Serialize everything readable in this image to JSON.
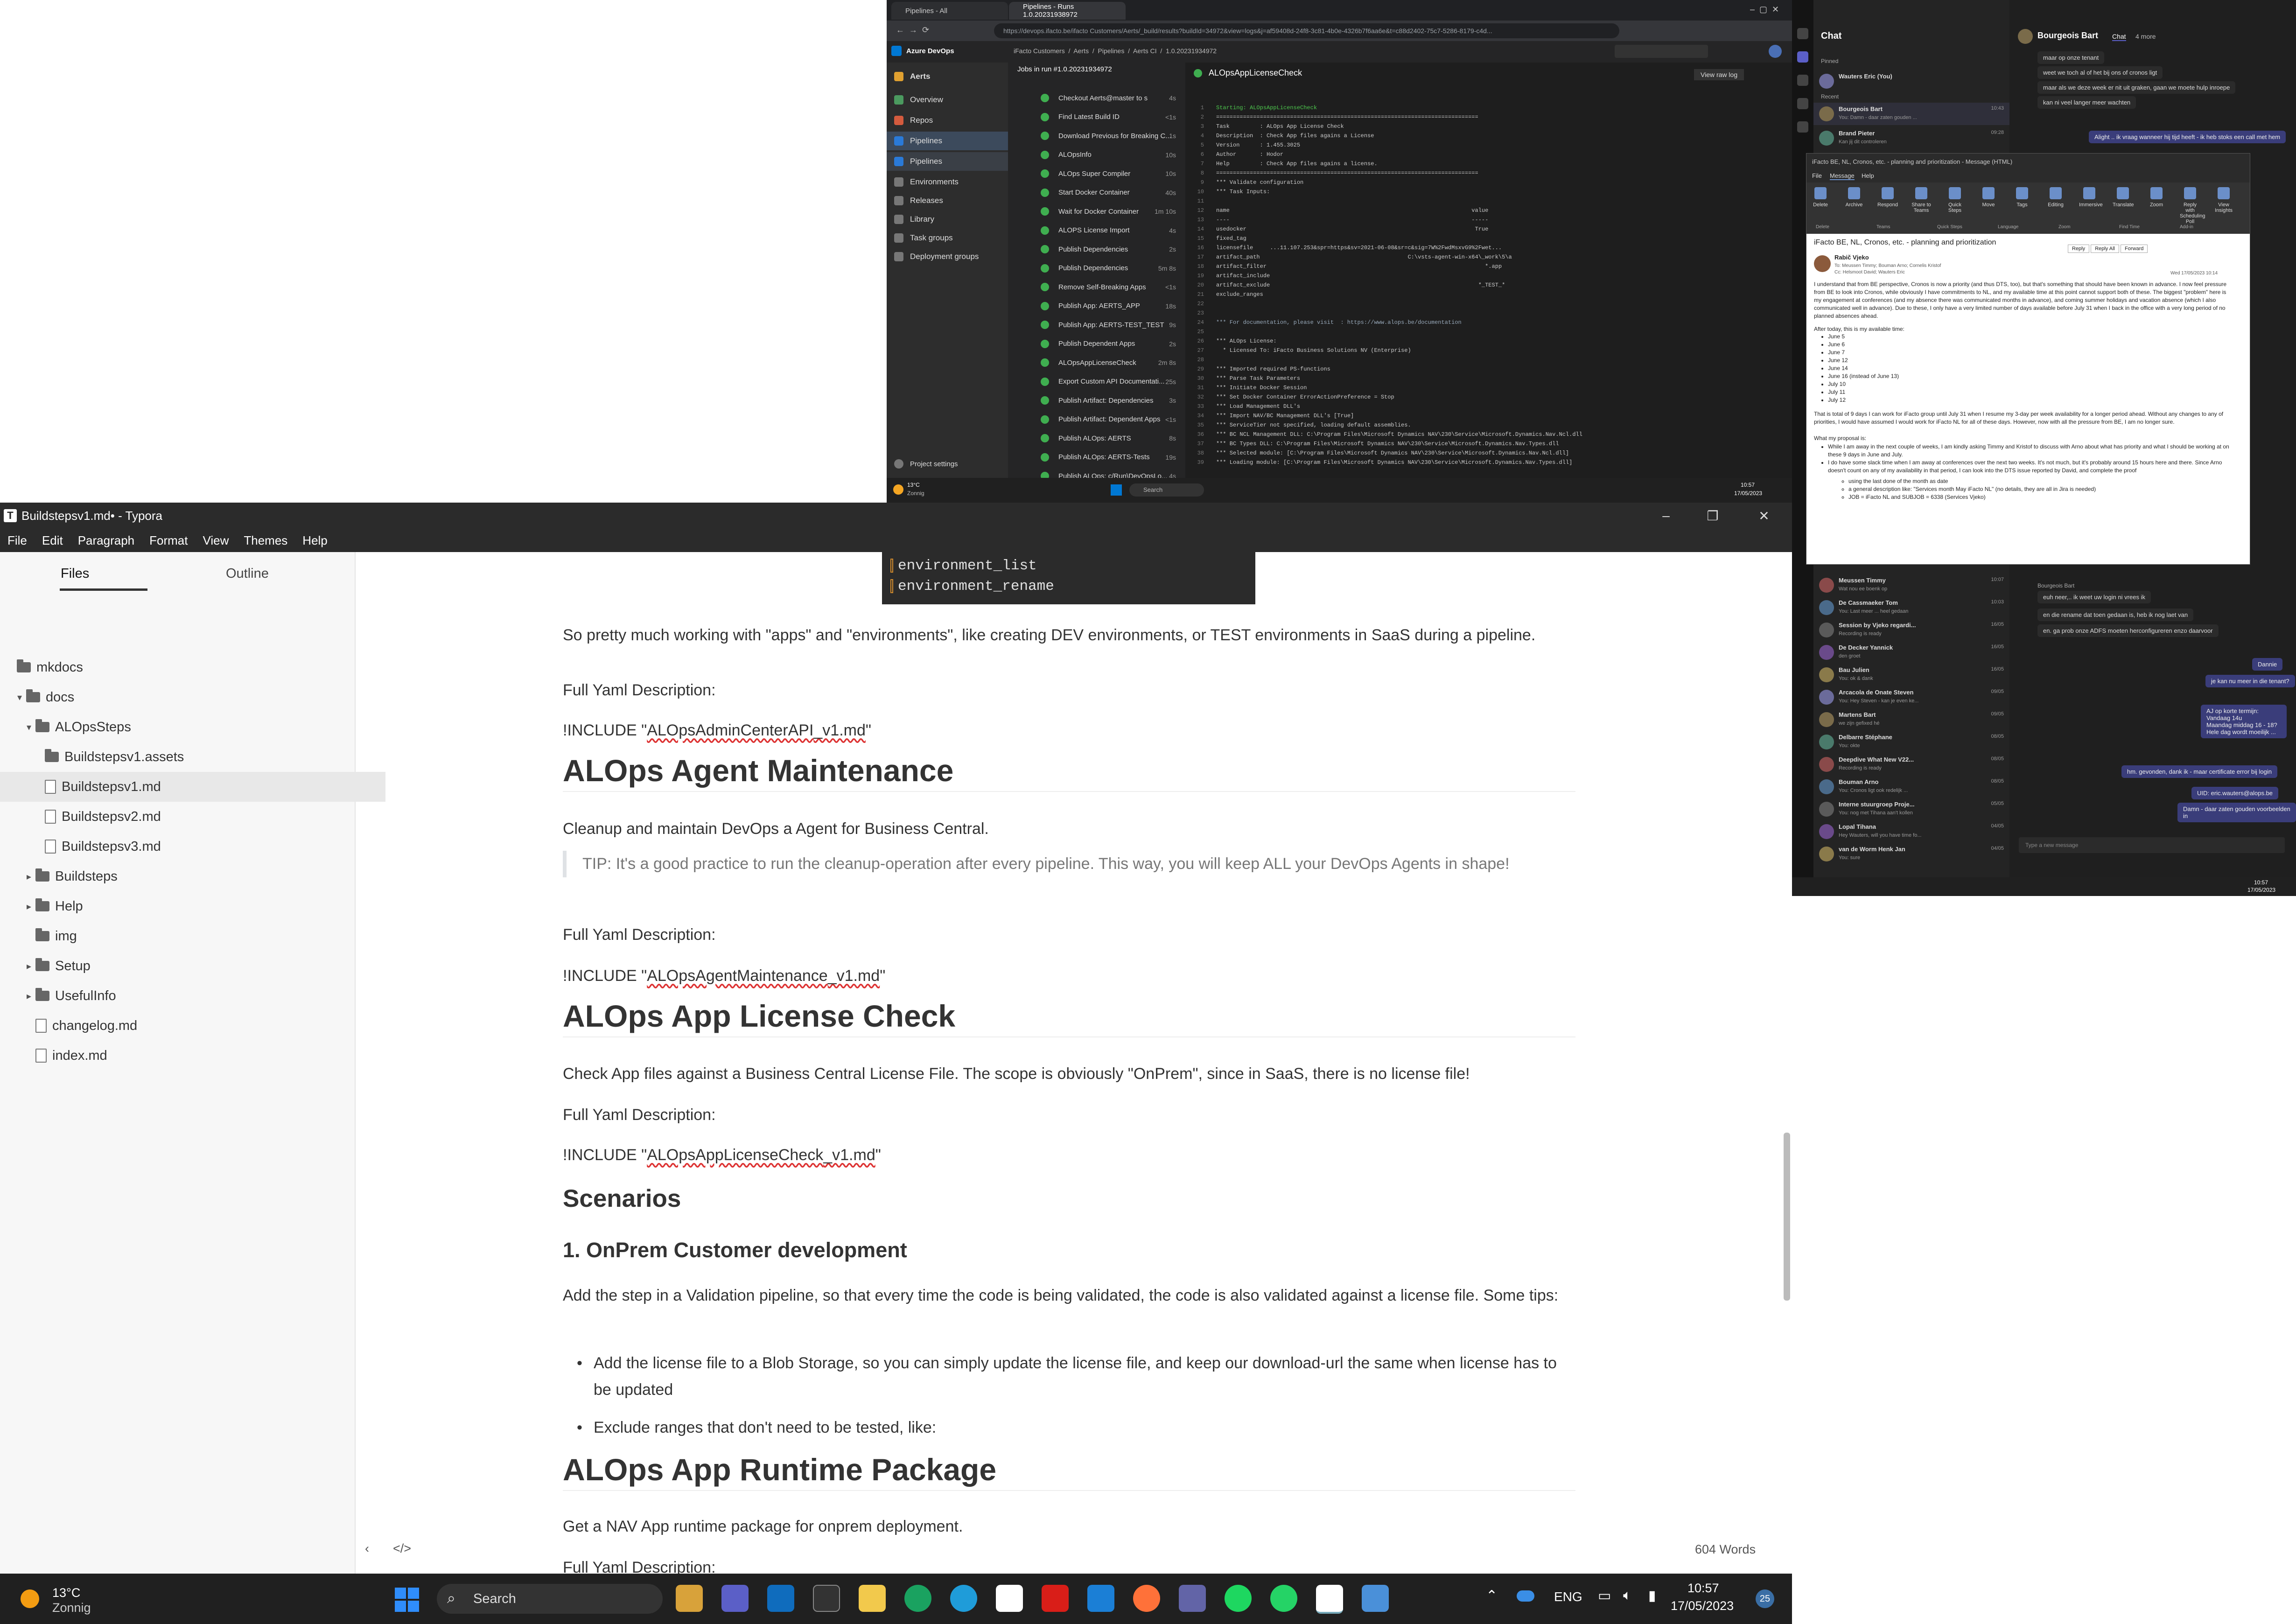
{
  "typora": {
    "title": "Buildstepsv1.md• - Typora",
    "menu": [
      "File",
      "Edit",
      "Paragraph",
      "Format",
      "View",
      "Themes",
      "Help"
    ],
    "tabs": {
      "files": "Files",
      "outline": "Outline"
    },
    "tree": [
      {
        "label": "mkdocs",
        "type": "folder",
        "depth": 0,
        "arrow": ""
      },
      {
        "label": "docs",
        "type": "folder",
        "depth": 1,
        "arrow": "▾"
      },
      {
        "label": "ALOpsSteps",
        "type": "folder",
        "depth": 2,
        "arrow": "▾"
      },
      {
        "label": "Buildstepsv1.assets",
        "type": "folder",
        "depth": 3,
        "arrow": ""
      },
      {
        "label": "Buildstepsv1.md",
        "type": "file",
        "depth": 3,
        "arrow": "",
        "selected": true
      },
      {
        "label": "Buildstepsv2.md",
        "type": "file",
        "depth": 3,
        "arrow": ""
      },
      {
        "label": "Buildstepsv3.md",
        "type": "file",
        "depth": 3,
        "arrow": ""
      },
      {
        "label": "Buildsteps",
        "type": "folder",
        "depth": 2,
        "arrow": "▸"
      },
      {
        "label": "Help",
        "type": "folder",
        "depth": 2,
        "arrow": "▸"
      },
      {
        "label": "img",
        "type": "folder",
        "depth": 2,
        "arrow": ""
      },
      {
        "label": "Setup",
        "type": "folder",
        "depth": 2,
        "arrow": "▸"
      },
      {
        "label": "UsefulInfo",
        "type": "folder",
        "depth": 2,
        "arrow": "▸"
      },
      {
        "label": "changelog.md",
        "type": "file",
        "depth": 2,
        "arrow": ""
      },
      {
        "label": "index.md",
        "type": "file",
        "depth": 2,
        "arrow": ""
      }
    ],
    "code_lines": [
      "environment_list",
      "environment_rename"
    ],
    "doc": {
      "p1": "So pretty much working with \"apps\" and \"environments\", like creating DEV environments, or TEST environments in SaaS during a pipeline.",
      "full_yaml": "Full Yaml Description:",
      "include_pre": "!INCLUDE \"",
      "include_post": "\"",
      "inc1": "ALOpsAdminCenterAPI",
      "inc1_suffix": "_v1.md",
      "h_agent": "ALOps Agent Maintenance",
      "agent_desc": "Cleanup and maintain DevOps a Agent for Business Central.",
      "tip": "TIP: It's a good practice to run the cleanup-operation after every pipeline.  This way, you will keep ALL your DevOps Agents in shape!",
      "inc2": "ALOpsAgentMaintenance",
      "inc2_suffix": "_v1.md",
      "h_license": "ALOps App License Check",
      "license_desc": "Check App files against a Business Central License File.  The scope is obviously \"OnPrem\", since in SaaS, there is no license file!",
      "inc3": "ALOpsAppLicenseCheck",
      "inc3_suffix": "_v1.md",
      "h_scen": "Scenarios",
      "h_onprem": "1. OnPrem Customer development",
      "onprem_desc": "Add the step in a Validation pipeline, so that every time the code is being validated, the code is also validated against a license file.  Some tips:",
      "bullet1": "Add the license file to a Blob Storage, so you can simply update the license file, and keep our download-url the same when license has to be updated",
      "bullet2": "Exclude ranges that don't need to be tested, like:",
      "h_runtime": "ALOps App Runtime Package",
      "runtime_desc": "Get a NAV App runtime package for onprem deployment.",
      "runtime_next": "Full Yaml Description:"
    },
    "word_count": "604 Words"
  },
  "taskbar": {
    "weather_temp": "13°C",
    "weather_desc": "Zonnig",
    "search": "Search",
    "lang": "ENG",
    "time": "10:57",
    "date": "17/05/2023",
    "badge": "25"
  },
  "ado": {
    "tabs": [
      "Pipelines - All",
      "Pipelines - Runs 1.0.20231938972"
    ],
    "url": "https://devops.ifacto.be/ifacto Customers/Aerts/_build/results?buildId=34972&view=logs&j=af59408d-24f8-3c81-4b0e-4326b7f6aa6e&t=c88d2402-75c7-5286-8179-c4d...",
    "brand": "Azure DevOps",
    "breadcrumb": [
      "iFacto Customers",
      "Aerts",
      "Pipelines",
      "Aerts CI",
      "1.0.20231934972"
    ],
    "project": "Aerts",
    "nav": [
      "Overview",
      "Repos",
      "Pipelines",
      "Pipelines",
      "Environments",
      "Releases",
      "Library",
      "Task groups",
      "Deployment groups"
    ],
    "project_settings": "Project settings",
    "jobs_title": "Jobs in run #1.0.20231934972",
    "jobs": [
      {
        "name": "Checkout Aerts@master to s",
        "dur": "4s"
      },
      {
        "name": "Find Latest Build ID",
        "dur": "<1s"
      },
      {
        "name": "Download Previous for Breaking C...",
        "dur": "1s"
      },
      {
        "name": "ALOpsInfo",
        "dur": "10s"
      },
      {
        "name": "ALOps Super Compiler",
        "dur": "10s"
      },
      {
        "name": "Start Docker Container",
        "dur": "40s"
      },
      {
        "name": "Wait for Docker Container",
        "dur": "1m 10s"
      },
      {
        "name": "ALOPS License Import",
        "dur": "4s"
      },
      {
        "name": "Publish Dependencies",
        "dur": "2s"
      },
      {
        "name": "Publish Dependencies",
        "dur": "5m 8s"
      },
      {
        "name": "Remove Self-Breaking Apps",
        "dur": "<1s"
      },
      {
        "name": "Publish App: AERTS_APP",
        "dur": "18s"
      },
      {
        "name": "Publish App: AERTS-TEST_TEST",
        "dur": "9s"
      },
      {
        "name": "Publish Dependent Apps",
        "dur": "2s"
      },
      {
        "name": "ALOpsAppLicenseCheck",
        "dur": "2m 8s"
      },
      {
        "name": "Export Custom API Documentati...",
        "dur": "25s"
      },
      {
        "name": "Publish Artifact: Dependencies",
        "dur": "3s"
      },
      {
        "name": "Publish Artifact: Dependent Apps",
        "dur": "<1s"
      },
      {
        "name": "Publish ALOps: AERTS",
        "dur": "8s"
      },
      {
        "name": "Publish ALOps: AERTS-Tests",
        "dur": "19s"
      },
      {
        "name": "Publish ALOps: c/Run\\DevOpsLo...",
        "dur": "4s"
      }
    ],
    "log_title": "ALOpsAppLicenseCheck",
    "view_raw": "View raw log",
    "log_lines": [
      "Starting: ALOpsAppLicenseCheck",
      "==============================================================================",
      "Task         : ALOps App License Check",
      "Description  : Check App files agains a License",
      "Version      : 1.455.3025",
      "Author       : Hodor",
      "Help         : Check App files agains a license.",
      "==============================================================================",
      "*** Validate configuration",
      "*** Task Inputs:",
      "",
      "name                                                                        value",
      "----                                                                        -----",
      "usedocker                                                                    True",
      "fixed_tag",
      "licensefile     ...11.107.253&spr=https&sv=2021-06-08&sr=c&sig=7W%2FwdMsxvG9%2Fwet...",
      "artifact_path                                            C:\\vsts-agent-win-x64\\_work\\5\\a",
      "artifact_filter                                                                 *.app",
      "artifact_include",
      "artifact_exclude                                                              *_TEST_*",
      "exclude_ranges",
      "",
      "",
      "*** For documentation, please visit  : https://www.alops.be/documentation",
      "",
      "*** ALOps License:",
      "  * Licensed To: iFacto Business Solutions NV (Enterprise)",
      "",
      "*** Imported required PS-functions",
      "*** Parse Task Parameters",
      "*** Initiate Docker Session",
      "*** Set Docker Container ErrorActionPreference = Stop",
      "*** Load Management DLL's",
      "*** Import NAV/BC Management DLL's [True]",
      "*** ServiceTier not specified, loading default assemblies.",
      "*** BC NCL Management DLL: C:\\Program Files\\Microsoft Dynamics NAV\\230\\Service\\Microsoft.Dynamics.Nav.Ncl.dll",
      "*** BC Types DLL: C:\\Program Files\\Microsoft Dynamics NAV\\230\\Service\\Microsoft.Dynamics.Nav.Types.dll",
      "*** Selected module: [C:\\Program Files\\Microsoft Dynamics NAV\\230\\Service\\Microsoft.Dynamics.Nav.Ncl.dll]",
      "*** Loading module: [C:\\Program Files\\Microsoft Dynamics NAV\\230\\Service\\Microsoft.Dynamics.Nav.Types.dll]"
    ],
    "tb_temp": "13°C",
    "tb_desc": "Zonnig",
    "tb_search": "Search",
    "tb_time": "10:57",
    "tb_date": "17/05/2023"
  },
  "teams": {
    "header": "Chat",
    "chat_person": "Bourgeois Bart",
    "chat_tab": "Chat",
    "more": "4 more",
    "pinned": "Pinned",
    "recent": "Recent",
    "list": [
      {
        "name": "Wauters Eric (You)",
        "preview": "",
        "date": ""
      },
      {
        "name": "Bourgeois Bart",
        "preview": "You: Damn - daar zaten gouden ...",
        "date": "10:43"
      },
      {
        "name": "Brand Pieter",
        "preview": "Kan jij dit controleren",
        "date": "09:28"
      },
      {
        "name": "Meussen Timmy",
        "preview": "Wat nou ee boenk op",
        "date": "10:07"
      },
      {
        "name": "De Cassmaeker Tom",
        "preview": "You: Last meer ... heel gedaan",
        "date": "10:03"
      },
      {
        "name": "Session by Vjeko regardi...",
        "preview": "Recording is ready",
        "date": "16/05"
      },
      {
        "name": "De Decker Yannick",
        "preview": "den groet",
        "date": "16/05"
      },
      {
        "name": "Bau Julien",
        "preview": "You: ok & dank",
        "date": "16/05"
      },
      {
        "name": "Arcacola de Onate Steven",
        "preview": "You: Hey Steven - kan je even ke...",
        "date": "09/05"
      },
      {
        "name": "Martens Bart",
        "preview": "we zijn gefixed hé",
        "date": "09/05"
      },
      {
        "name": "Delbarre Stéphane",
        "preview": "You: okte",
        "date": "08/05"
      },
      {
        "name": "Deepdive What New V22...",
        "preview": "Recording is ready",
        "date": "08/05"
      },
      {
        "name": "Bouman Arno",
        "preview": "You: Cronos ligt ook redelijk ...",
        "date": "08/05"
      },
      {
        "name": "Interne stuurgroep Proje...",
        "preview": "You: nog met Tihana aan't kollen",
        "date": "05/05"
      },
      {
        "name": "Lopal Tihana",
        "preview": "Hey Wauters, will you have time fo...",
        "date": "04/05"
      },
      {
        "name": "van de Worm Henk Jan",
        "preview": "You: sure",
        "date": "04/05"
      }
    ],
    "messages_top": [
      "maar op onze tenant",
      "weet we toch al of het bij ons of cronos ligt",
      "maar als we deze week er nit uit graken, gaan we moete hulp inroepe",
      "kan ni veel langer meer wachten"
    ],
    "msg_me_top": "Alight .. ik vraag wanneer hij tijd heeft - ik heb stoks een call met hem",
    "messages_mid": [
      "euh neer,.. ik weet uw login ni vrees ik",
      "en die rename dat toen gedaan is, heb ik nog laet van",
      "en. ga prob onze ADFS moeten herconfigureren enzo daarvoor"
    ],
    "sender_mid": "Bourgeois Bart",
    "me_msgs": [
      "Dannie",
      "je kan nu meer in die tenant?",
      "AJ op korte termijn:",
      "Vandaag 14u",
      "Maandag middag 16 - 18?",
      "Hele dag wordt moeilijk ...",
      "hm. gevonden, dank ik - maar certificate error bij login",
      "UID: eric.wauters@alops.be",
      "Damn - daar zaten gouden voorbeelden in"
    ],
    "compose": "Type a new message",
    "tb_time": "10:57",
    "tb_date": "17/05/2023"
  },
  "mail": {
    "window_title": "iFacto BE, NL, Cronos, etc. - planning and prioritization - Message (HTML)",
    "tabs": [
      "File",
      "Message",
      "Help"
    ],
    "ribbon": [
      "Delete",
      "Archive",
      "Respond",
      "Share to Teams",
      "Quick Steps",
      "Move",
      "Tags",
      "Editing",
      "Immersive",
      "Translate",
      "Zoom",
      "Reply with Scheduling Poll",
      "View Insights"
    ],
    "ribbon_groups": [
      "Delete",
      "Teams",
      "Quick Steps",
      "Language",
      "Zoom",
      "Find Time",
      "Add-in"
    ],
    "subject": "iFacto BE, NL, Cronos, etc. - planning and prioritization",
    "from": "Rabič Vjeko",
    "to": "To: Meussen Timmy; Bouman Arno; Cornelis Kristof",
    "cc": "Cc: Helsmoot David; Wauters Eric",
    "date": "Wed 17/05/2023 10:14",
    "actions": [
      "Reply",
      "Reply All",
      "Forward"
    ],
    "body_p1": "I understand that from BE perspective, Cronos is now a priority (and thus DTS, too), but that's something that should have been known in advance. I now feel pressure from BE to look into Cronos, while obviously I have commitments to NL, and my available time at this point cannot support both of these. The biggest \"problem\" here is my engagement at conferences (and my absence there was communicated months in advance), and coming summer holidays and vacation absence (which I also communicated well in advance). Due to these, I only have a very limited number of days available before July 31 when I back in the office with a very long period of no planned absences ahead.",
    "body_p2": "After today, this is my available time:",
    "days": [
      "June 5",
      "June 6",
      "June 7",
      "June 12",
      "June 14",
      "June 16 (instead of June 13)",
      "July 10",
      "July 11",
      "July 12"
    ],
    "body_p3": "That is total of 9 days I can work for iFacto group until July 31 when I resume my 3-day per week availability for a longer period ahead. Without any changes to any of priorities, I would have assumed I would work for iFacto NL for all of these days. However, now with all the pressure from BE, I am no longer sure.",
    "body_p4": "What my proposal is:",
    "proposals": [
      "While I am away in the next couple of weeks, I am kindly asking Timmy and Kristof to discuss with Arno about what has priority and what I should be working at on these 9 days in June and July.",
      "I do have some slack time when I am away at conferences over the next two weeks. It's not much, but it's probably around 15 hours here and there. Since Arno doesn't count on any of my availability in that period, I can look into the DTS issue reported by David, and complete the proof"
    ],
    "subs": [
      "using the last done of the month as date",
      "a general description like: \"Services month May iFacto NL\" (no details, they are all in Jira is needed)",
      "JOB = iFacto NL and SUBJOB = 6338 (Services Vjeko)"
    ]
  },
  "colors": {
    "accent_ado": "#0078d4",
    "green_ok": "#3fae50",
    "teams_purple": "#5b5fc7"
  }
}
